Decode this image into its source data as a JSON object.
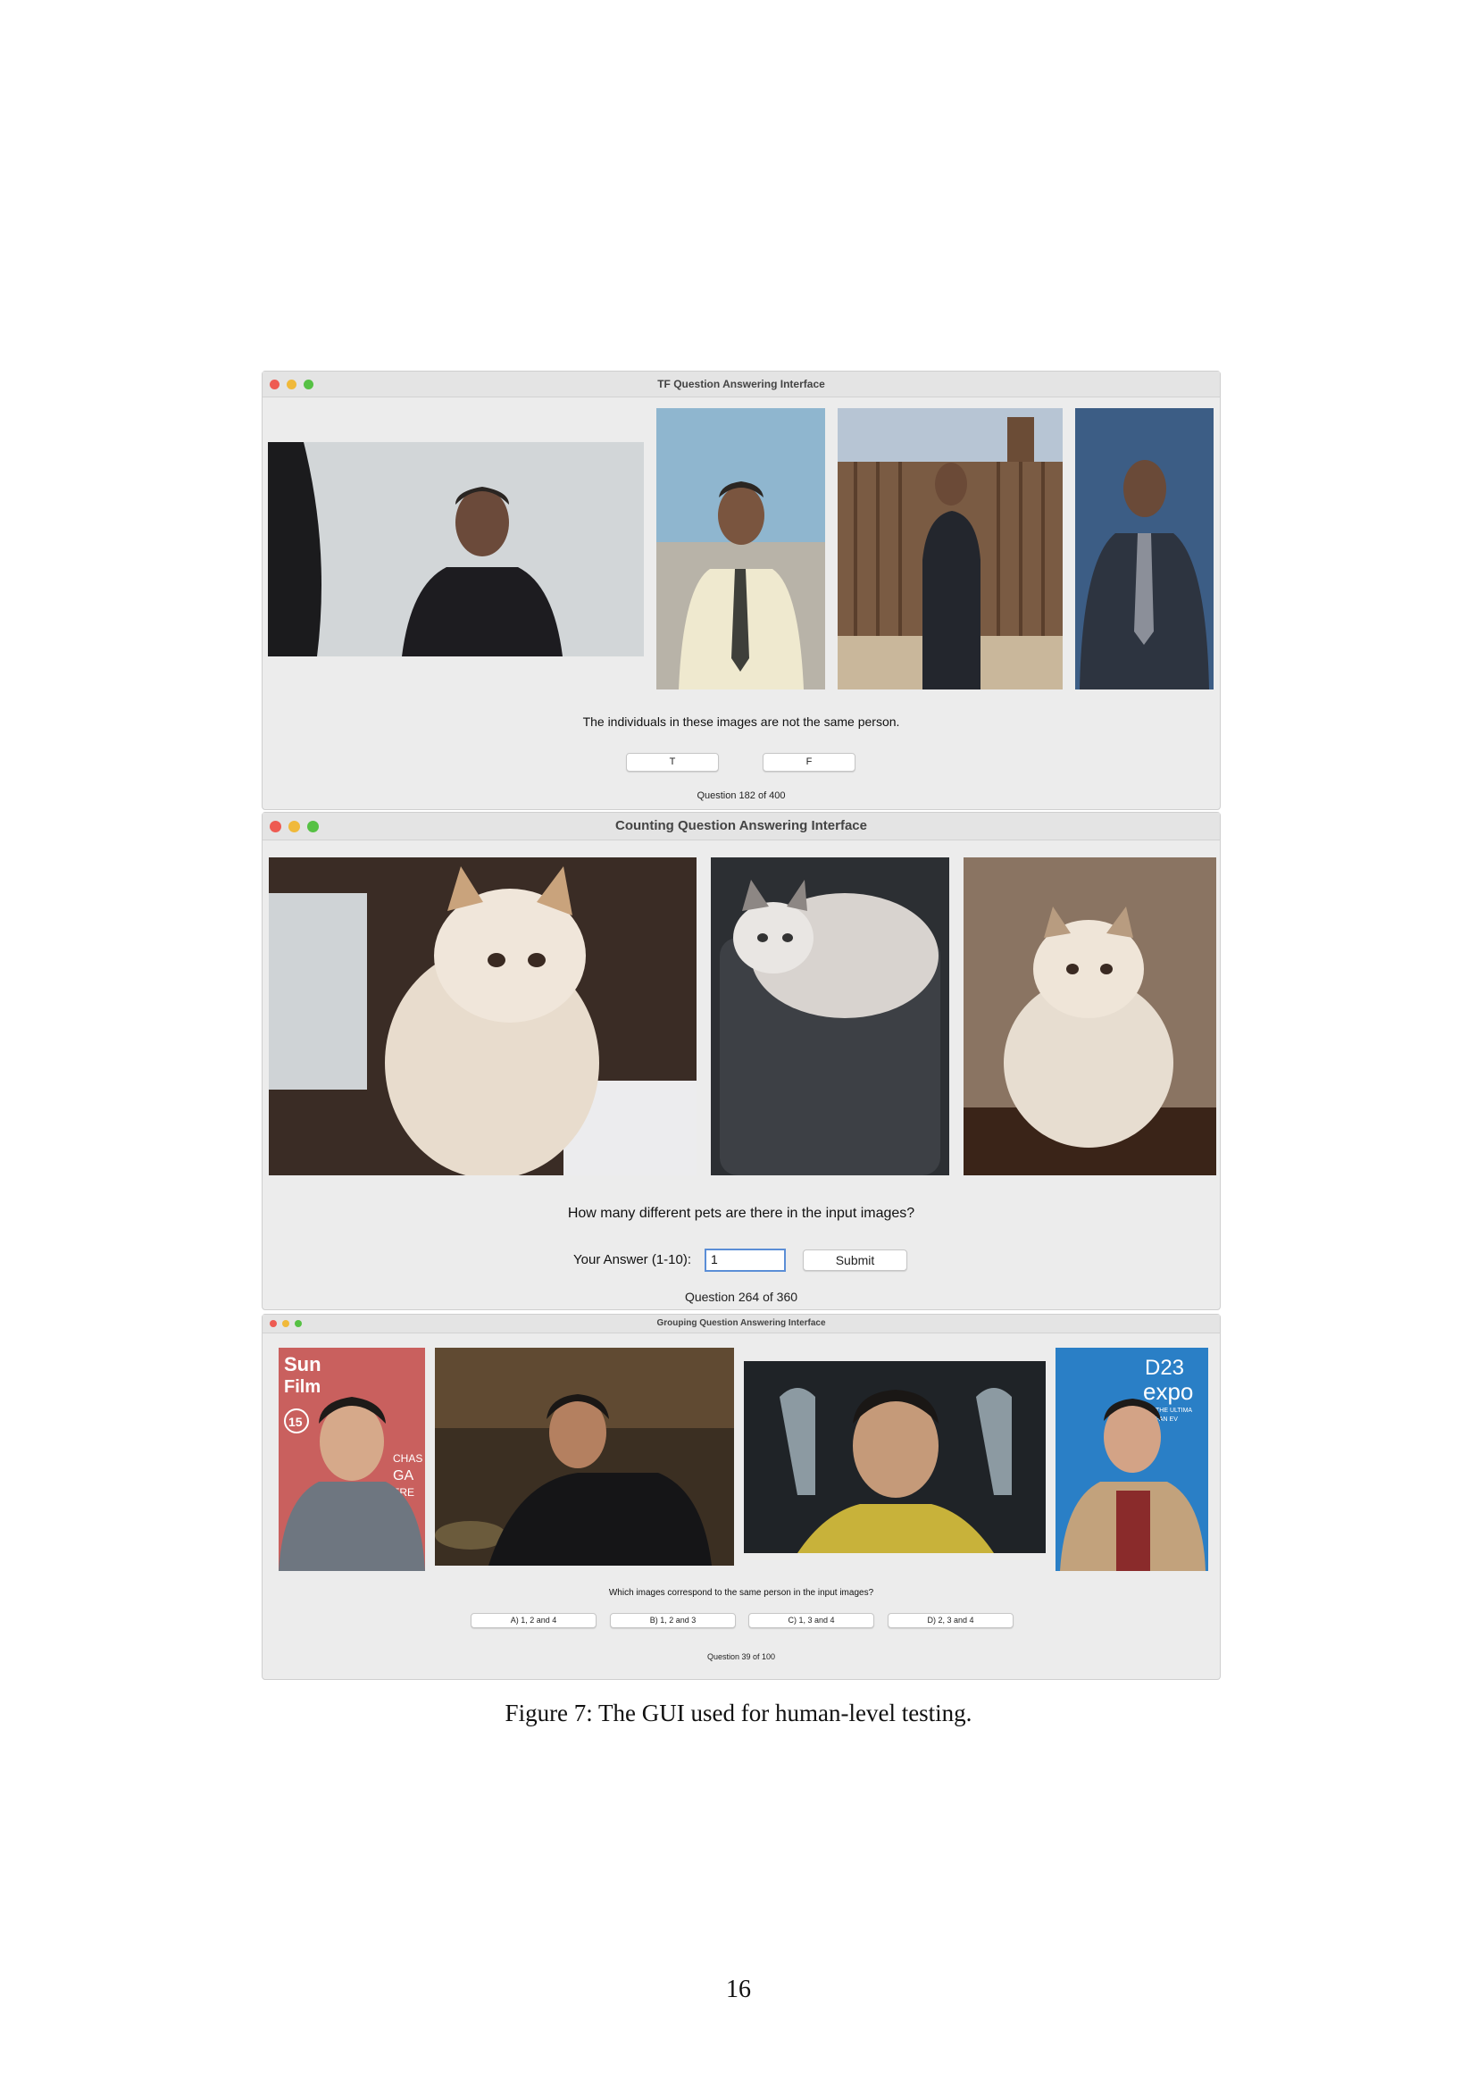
{
  "figure": {
    "caption": "Figure 7: The GUI used for human-level testing.",
    "page_number": "16"
  },
  "tf_window": {
    "title": "TF Question Answering Interface",
    "question": "The individuals in these images are not the same person.",
    "buttons": [
      "T",
      "F"
    ],
    "counter": "Question 182 of 400"
  },
  "counting_window": {
    "title": "Counting Question Answering Interface",
    "question": "How many different pets are there in the input images?",
    "answer_label": "Your Answer (1-10):",
    "answer_value": "1",
    "submit_label": "Submit",
    "counter": "Question 264 of 360"
  },
  "grouping_window": {
    "title": "Grouping Question Answering Interface",
    "question": "Which images correspond to the same person in the input images?",
    "options": [
      "A) 1, 2 and 4",
      "B) 1, 2 and 3",
      "C) 1, 3 and 4",
      "D) 2, 3 and 4"
    ],
    "counter": "Question 39 of 100",
    "photo_texts": {
      "banner_left": "Sun",
      "banner_left_2": "Film",
      "banner_badge": "15",
      "banner_side": "CHAS",
      "banner_side_2": "GA",
      "banner_side_3": "FRE",
      "banner_right": "D23",
      "banner_right_2": "expo",
      "banner_right_3": "THE ULTIMA",
      "banner_right_4": "FAN EV"
    }
  }
}
